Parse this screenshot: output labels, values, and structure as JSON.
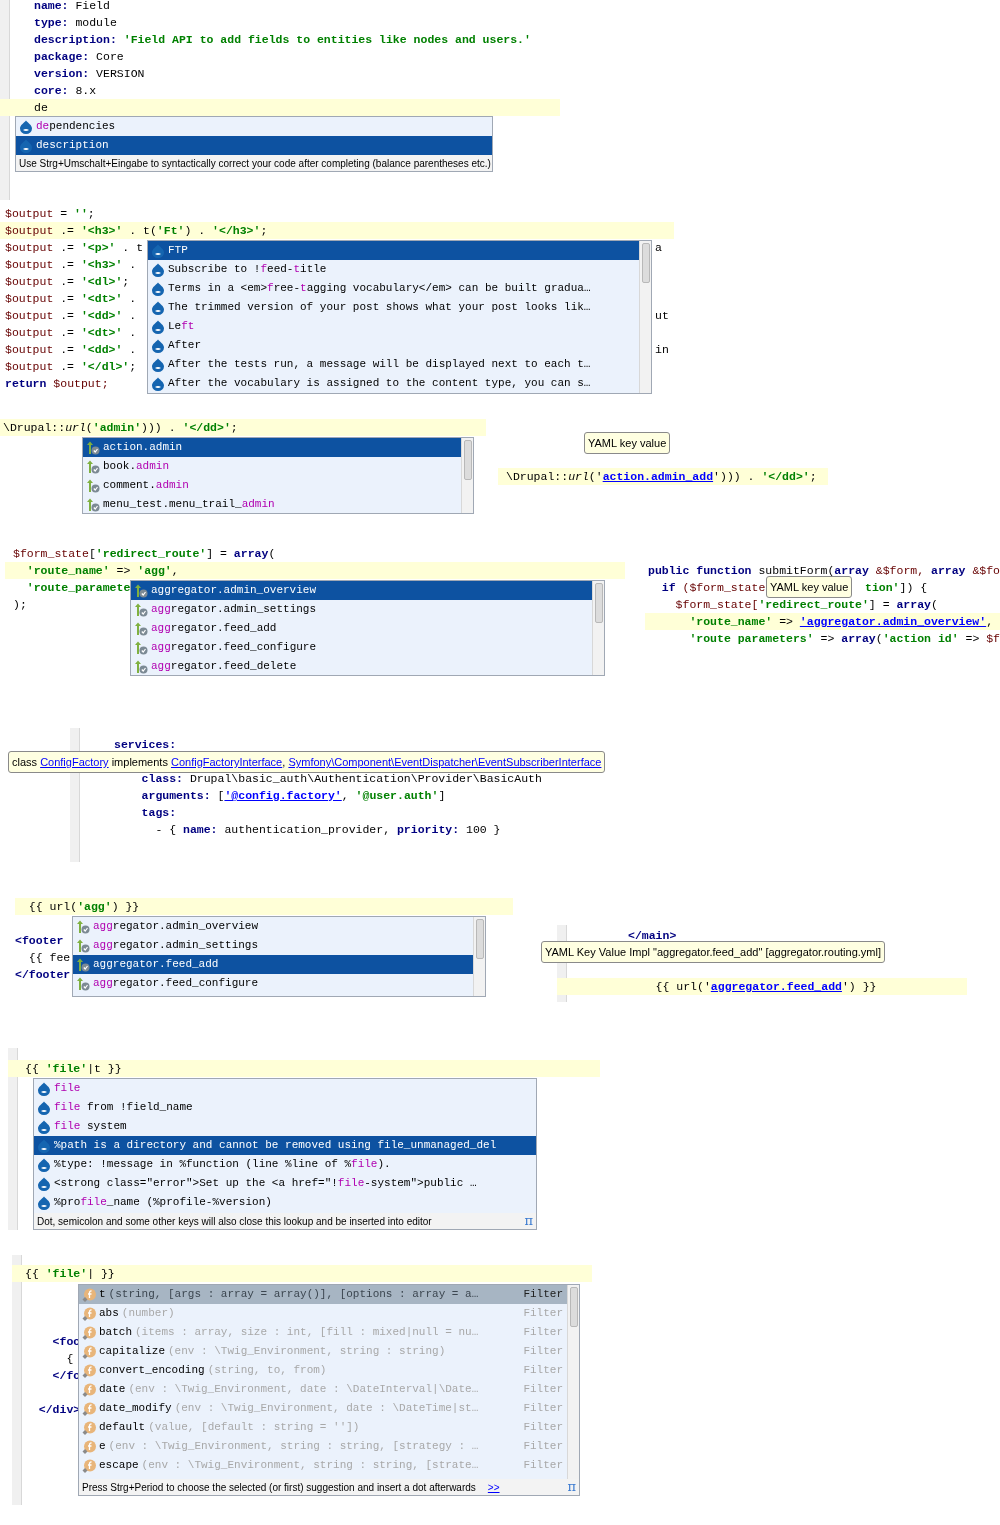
{
  "panels": [
    {
      "kind": "editor",
      "lines": [
        {
          "current": false,
          "segments": [
            {
              "text": "name:",
              "kind": "key"
            },
            {
              "text": " Field",
              "kind": "plain"
            }
          ]
        },
        {
          "current": false,
          "segments": [
            {
              "text": "type:",
              "kind": "key"
            },
            {
              "text": " module",
              "kind": "plain"
            }
          ]
        },
        {
          "current": false,
          "segments": [
            {
              "text": "description:",
              "kind": "key"
            },
            {
              "text": " 'Field API to add fields to entities like nodes and users.'",
              "kind": "str"
            }
          ]
        },
        {
          "current": false,
          "segments": [
            {
              "text": "package:",
              "kind": "key"
            },
            {
              "text": " Core",
              "kind": "plain"
            }
          ]
        },
        {
          "current": false,
          "segments": [
            {
              "text": "version:",
              "kind": "key"
            },
            {
              "text": " VERSION",
              "kind": "plain"
            }
          ]
        },
        {
          "current": false,
          "segments": [
            {
              "text": "core:",
              "kind": "key"
            },
            {
              "text": " 8.x",
              "kind": "plain"
            }
          ]
        },
        {
          "current": true,
          "segments": [
            {
              "text": "de",
              "kind": "plain"
            }
          ]
        }
      ],
      "popup": {
        "kind": "translation",
        "items": [
          {
            "selected": false,
            "segments": [
              {
                "text": "de",
                "kind": "match"
              },
              {
                "text": "pendencies",
                "kind": "plain"
              }
            ]
          },
          {
            "selected": true,
            "segments": [
              {
                "text": "description",
                "kind": "plain"
              }
            ]
          }
        ],
        "hint": "Use Strg+Umschalt+Eingabe to syntactically correct your code after completing (balance parentheses etc.)"
      }
    },
    {
      "kind": "editor",
      "lines": [
        {
          "current": false,
          "segments": [
            {
              "text": "$output",
              "kind": "var"
            },
            {
              "text": " = ",
              "kind": "plain"
            },
            {
              "text": "''",
              "kind": "str"
            },
            {
              "text": ";",
              "kind": "plain"
            }
          ]
        },
        {
          "current": true,
          "segments": [
            {
              "text": "$output",
              "kind": "var"
            },
            {
              "text": " .= ",
              "kind": "plain"
            },
            {
              "text": "'<h3>'",
              "kind": "str"
            },
            {
              "text": " . t(",
              "kind": "plain"
            },
            {
              "text": "'Ft'",
              "kind": "str"
            },
            {
              "text": ") . ",
              "kind": "plain"
            },
            {
              "text": "'</h3>'",
              "kind": "str"
            },
            {
              "text": ";",
              "kind": "plain"
            }
          ]
        },
        {
          "current": false,
          "segments": [
            {
              "text": "$output",
              "kind": "var"
            },
            {
              "text": " .= ",
              "kind": "plain"
            },
            {
              "text": "'<p>'",
              "kind": "str"
            },
            {
              "text": " . t",
              "kind": "plain"
            }
          ],
          "tail": [
            {
              "text": "a",
              "kind": "plain"
            }
          ]
        },
        {
          "current": false,
          "segments": [
            {
              "text": "$output",
              "kind": "var"
            },
            {
              "text": " .= ",
              "kind": "plain"
            },
            {
              "text": "'<h3>'",
              "kind": "str"
            },
            {
              "text": " .",
              "kind": "plain"
            }
          ]
        },
        {
          "current": false,
          "segments": [
            {
              "text": "$output",
              "kind": "var"
            },
            {
              "text": " .= ",
              "kind": "plain"
            },
            {
              "text": "'<dl>'",
              "kind": "str"
            },
            {
              "text": ";",
              "kind": "plain"
            }
          ]
        },
        {
          "current": false,
          "segments": [
            {
              "text": "$output",
              "kind": "var"
            },
            {
              "text": " .= ",
              "kind": "plain"
            },
            {
              "text": "'<dt>'",
              "kind": "str"
            },
            {
              "text": " .",
              "kind": "plain"
            }
          ]
        },
        {
          "current": false,
          "segments": [
            {
              "text": "$output",
              "kind": "var"
            },
            {
              "text": " .= ",
              "kind": "plain"
            },
            {
              "text": "'<dd>'",
              "kind": "str"
            },
            {
              "text": " .",
              "kind": "plain"
            }
          ],
          "tail": [
            {
              "text": "ut",
              "kind": "plain"
            }
          ]
        },
        {
          "current": false,
          "segments": [
            {
              "text": "$output",
              "kind": "var"
            },
            {
              "text": " .= ",
              "kind": "plain"
            },
            {
              "text": "'<dt>'",
              "kind": "str"
            },
            {
              "text": " .",
              "kind": "plain"
            }
          ]
        },
        {
          "current": false,
          "segments": [
            {
              "text": "$output",
              "kind": "var"
            },
            {
              "text": " .= ",
              "kind": "plain"
            },
            {
              "text": "'<dd>'",
              "kind": "str"
            },
            {
              "text": " .",
              "kind": "plain"
            }
          ],
          "tail": [
            {
              "text": "in",
              "kind": "plain"
            }
          ]
        },
        {
          "current": false,
          "segments": [
            {
              "text": "$output",
              "kind": "var"
            },
            {
              "text": " .= ",
              "kind": "plain"
            },
            {
              "text": "'</dl>'",
              "kind": "str"
            },
            {
              "text": ";",
              "kind": "plain"
            }
          ]
        },
        {
          "current": false,
          "segments": [
            {
              "text": "return",
              "kind": "kw"
            },
            {
              "text": " $output;",
              "kind": "var"
            }
          ]
        }
      ],
      "popup": {
        "kind": "translation",
        "items": [
          {
            "selected": true,
            "segments": [
              {
                "text": "FTP",
                "kind": "plain"
              }
            ]
          },
          {
            "selected": false,
            "segments": [
              {
                "text": "Subscribe to !",
                "kind": "plain"
              },
              {
                "text": "f",
                "kind": "match"
              },
              {
                "text": "eed-",
                "kind": "plain"
              },
              {
                "text": "t",
                "kind": "match"
              },
              {
                "text": "itle",
                "kind": "plain"
              }
            ]
          },
          {
            "selected": false,
            "segments": [
              {
                "text": "Terms in a <em>",
                "kind": "plain"
              },
              {
                "text": "f",
                "kind": "match"
              },
              {
                "text": "ree-",
                "kind": "plain"
              },
              {
                "text": "t",
                "kind": "match"
              },
              {
                "text": "agging vocabulary</em> can be built gradua…",
                "kind": "plain"
              }
            ]
          },
          {
            "selected": false,
            "segments": [
              {
                "text": "The trimmed version of your post shows what your post looks lik…",
                "kind": "plain"
              }
            ]
          },
          {
            "selected": false,
            "segments": [
              {
                "text": "Le",
                "kind": "plain"
              },
              {
                "text": "ft",
                "kind": "match"
              }
            ]
          },
          {
            "selected": false,
            "segments": [
              {
                "text": "After",
                "kind": "plain"
              }
            ]
          },
          {
            "selected": false,
            "segments": [
              {
                "text": "After the tests run, a message will be displayed next to each t…",
                "kind": "plain"
              }
            ]
          },
          {
            "selected": false,
            "segments": [
              {
                "text": "After the vocabulary is assigned to the content type, you can s…",
                "kind": "plain"
              }
            ]
          }
        ]
      }
    },
    {
      "kind": "editor",
      "lines": [
        {
          "current": true,
          "segments": [
            {
              "text": "\\Drupal::",
              "kind": "plain"
            },
            {
              "text": "url",
              "kind": "fn"
            },
            {
              "text": "(",
              "kind": "plain"
            },
            {
              "text": "'admin'",
              "kind": "str"
            },
            {
              "text": "))) . ",
              "kind": "plain"
            },
            {
              "text": "'</dd>'",
              "kind": "str"
            },
            {
              "text": ";",
              "kind": "plain"
            }
          ]
        }
      ],
      "popup": {
        "kind": "route",
        "items": [
          {
            "selected": true,
            "segments": [
              {
                "text": "action.admin",
                "kind": "plain"
              }
            ]
          },
          {
            "selected": false,
            "segments": [
              {
                "text": "book.",
                "kind": "plain"
              },
              {
                "text": "admin",
                "kind": "match"
              }
            ]
          },
          {
            "selected": false,
            "segments": [
              {
                "text": "comment.",
                "kind": "plain"
              },
              {
                "text": "admin",
                "kind": "match"
              }
            ]
          },
          {
            "selected": false,
            "segments": [
              {
                "text": "menu_test.menu_trail_",
                "kind": "plain"
              },
              {
                "text": "admin",
                "kind": "match"
              }
            ]
          }
        ]
      }
    },
    {
      "kind": "editor",
      "lines": [
        {
          "current": true,
          "segments": [
            {
              "text": "\\Drupal::",
              "kind": "plain"
            },
            {
              "text": "url",
              "kind": "fn"
            },
            {
              "text": "('",
              "kind": "plain"
            },
            {
              "text": "action.admin_add",
              "kind": "link"
            },
            {
              "text": "'))) . ",
              "kind": "plain"
            },
            {
              "text": "'</dd>'",
              "kind": "str"
            },
            {
              "text": ";",
              "kind": "plain"
            }
          ]
        }
      ],
      "tooltip": {
        "segments": [
          {
            "text": "YAML key value",
            "kind": "plain"
          }
        ]
      }
    },
    {
      "kind": "editor",
      "lines": [
        {
          "current": false,
          "segments": [
            {
              "text": "$form_state",
              "kind": "var"
            },
            {
              "text": "[",
              "kind": "plain"
            },
            {
              "text": "'redirect_route'",
              "kind": "str"
            },
            {
              "text": "] = ",
              "kind": "plain"
            },
            {
              "text": "array",
              "kind": "kw"
            },
            {
              "text": "(",
              "kind": "plain"
            }
          ]
        },
        {
          "current": true,
          "segments": [
            {
              "text": "  'route_name'",
              "kind": "str"
            },
            {
              "text": " => ",
              "kind": "plain"
            },
            {
              "text": "'agg'",
              "kind": "str"
            },
            {
              "text": ",",
              "kind": "plain"
            }
          ]
        },
        {
          "current": false,
          "segments": [
            {
              "text": "  'route_paramete",
              "kind": "str"
            }
          ]
        },
        {
          "current": false,
          "segments": [
            {
              "text": ");",
              "kind": "plain"
            }
          ]
        }
      ],
      "popup": {
        "kind": "route",
        "items": [
          {
            "selected": true,
            "segments": [
              {
                "text": "aggregator.admin_overview",
                "kind": "plain"
              }
            ]
          },
          {
            "selected": false,
            "segments": [
              {
                "text": "agg",
                "kind": "match"
              },
              {
                "text": "regator.admin_settings",
                "kind": "plain"
              }
            ]
          },
          {
            "selected": false,
            "segments": [
              {
                "text": "agg",
                "kind": "match"
              },
              {
                "text": "regator.feed_add",
                "kind": "plain"
              }
            ]
          },
          {
            "selected": false,
            "segments": [
              {
                "text": "agg",
                "kind": "match"
              },
              {
                "text": "regator.feed_configure",
                "kind": "plain"
              }
            ]
          },
          {
            "selected": false,
            "segments": [
              {
                "text": "agg",
                "kind": "match"
              },
              {
                "text": "regator.feed_delete",
                "kind": "plain"
              }
            ]
          }
        ]
      }
    },
    {
      "kind": "editor",
      "lines": [
        {
          "current": false,
          "segments": [
            {
              "text": "public function",
              "kind": "kw"
            },
            {
              "text": " submitForm(",
              "kind": "plain"
            },
            {
              "text": "array",
              "kind": "kw"
            },
            {
              "text": " &$form, ",
              "kind": "var"
            },
            {
              "text": "array",
              "kind": "kw"
            },
            {
              "text": " &$fo",
              "kind": "var"
            }
          ]
        },
        {
          "current": false,
          "segments": [
            {
              "text": "  if",
              "kind": "kw"
            },
            {
              "text": " ($form_state",
              "kind": "var"
            }
          ],
          "tail": [
            {
              "text": "tion'",
              "kind": "str"
            },
            {
              "text": "]) {",
              "kind": "plain"
            }
          ]
        },
        {
          "current": false,
          "segments": [
            {
              "text": "    $form_state[",
              "kind": "var"
            },
            {
              "text": "'redirect_route'",
              "kind": "str"
            },
            {
              "text": "] = ",
              "kind": "plain"
            },
            {
              "text": "array",
              "kind": "kw"
            },
            {
              "text": "(",
              "kind": "plain"
            }
          ]
        },
        {
          "current": true,
          "segments": [
            {
              "text": "      'route_name'",
              "kind": "str"
            },
            {
              "text": " => ",
              "kind": "plain"
            },
            {
              "text": "'aggregator.admin_overview'",
              "kind": "link"
            },
            {
              "text": ",",
              "kind": "plain"
            }
          ]
        },
        {
          "current": false,
          "segments": [
            {
              "text": "      'route parameters'",
              "kind": "str"
            },
            {
              "text": " => ",
              "kind": "plain"
            },
            {
              "text": "array",
              "kind": "kw"
            },
            {
              "text": "(",
              "kind": "plain"
            },
            {
              "text": "'action id'",
              "kind": "str"
            },
            {
              "text": " => ",
              "kind": "plain"
            },
            {
              "text": "$f",
              "kind": "var"
            }
          ]
        }
      ],
      "tooltip": {
        "segments": [
          {
            "text": "YAML key value",
            "kind": "plain"
          }
        ]
      }
    },
    {
      "kind": "editor",
      "lines": [
        {
          "current": false,
          "segments": [
            {
              "text": "services:",
              "kind": "key"
            }
          ]
        },
        {
          "current": false,
          "segments": [
            {
              "text": "    class:",
              "kind": "key"
            },
            {
              "text": " Drupal\\basic_auth\\Authentication\\Provider\\BasicAuth",
              "kind": "plain"
            }
          ]
        },
        {
          "current": false,
          "segments": [
            {
              "text": "    arguments:",
              "kind": "key"
            },
            {
              "text": " [",
              "kind": "plain"
            },
            {
              "text": "'@config.factory'",
              "kind": "link"
            },
            {
              "text": ", ",
              "kind": "plain"
            },
            {
              "text": "'@user.auth'",
              "kind": "str"
            },
            {
              "text": "]",
              "kind": "plain"
            }
          ]
        },
        {
          "current": false,
          "segments": [
            {
              "text": "    tags:",
              "kind": "key"
            }
          ]
        },
        {
          "current": false,
          "segments": [
            {
              "text": "      - { ",
              "kind": "plain"
            },
            {
              "text": "name:",
              "kind": "key"
            },
            {
              "text": " authentication_provider, ",
              "kind": "plain"
            },
            {
              "text": "priority:",
              "kind": "key"
            },
            {
              "text": " 100 }",
              "kind": "plain"
            }
          ]
        }
      ],
      "tooltip": {
        "segments": [
          {
            "text": "class ",
            "kind": "plain"
          },
          {
            "text": "ConfigFactory",
            "kind": "link"
          },
          {
            "text": " implements ",
            "kind": "plain"
          },
          {
            "text": "ConfigFactoryInterface",
            "kind": "link"
          },
          {
            "text": ", ",
            "kind": "plain"
          },
          {
            "text": "Symfony\\Component\\EventDispatcher\\EventSubscriberInterface",
            "kind": "link"
          }
        ]
      }
    },
    {
      "kind": "editor",
      "lines": [
        {
          "current": true,
          "segments": [
            {
              "text": "  {{ url(",
              "kind": "plain"
            },
            {
              "text": "'agg'",
              "kind": "str"
            },
            {
              "text": ") }}",
              "kind": "plain"
            }
          ]
        },
        {
          "current": false,
          "segments": [
            {
              "text": "<footer",
              "kind": "tag"
            }
          ]
        },
        {
          "current": false,
          "segments": [
            {
              "text": "  {{ fee",
              "kind": "plain"
            }
          ]
        },
        {
          "current": false,
          "segments": [
            {
              "text": "</footer",
              "kind": "tag"
            }
          ]
        }
      ],
      "popup": {
        "kind": "route",
        "items": [
          {
            "selected": false,
            "segments": [
              {
                "text": "agg",
                "kind": "match"
              },
              {
                "text": "regator.admin_overview",
                "kind": "plain"
              }
            ]
          },
          {
            "selected": false,
            "segments": [
              {
                "text": "agg",
                "kind": "match"
              },
              {
                "text": "regator.admin_settings",
                "kind": "plain"
              }
            ]
          },
          {
            "selected": true,
            "segments": [
              {
                "text": "aggregator.feed_add",
                "kind": "plain"
              }
            ]
          },
          {
            "selected": false,
            "segments": [
              {
                "text": "agg",
                "kind": "match"
              },
              {
                "text": "regator.feed_configure",
                "kind": "plain"
              }
            ]
          }
        ]
      }
    },
    {
      "kind": "editor",
      "lines": [
        {
          "current": false,
          "segments": [
            {
              "text": "</main>",
              "kind": "tag"
            }
          ]
        },
        {
          "current": true,
          "segments": [
            {
              "text": "    {{ url('",
              "kind": "plain"
            },
            {
              "text": "aggregator.feed_add",
              "kind": "link"
            },
            {
              "text": "') }}",
              "kind": "plain"
            }
          ]
        }
      ],
      "tooltip": {
        "segments": [
          {
            "text": "YAML Key Value Impl \"aggregator.feed_add\" [aggregator.routing.yml]",
            "kind": "plain"
          }
        ]
      }
    },
    {
      "kind": "editor",
      "lines": [
        {
          "current": true,
          "segments": [
            {
              "text": "{{ ",
              "kind": "plain"
            },
            {
              "text": "'file'",
              "kind": "str"
            },
            {
              "text": "|t }}",
              "kind": "plain"
            }
          ]
        }
      ],
      "popup": {
        "kind": "translation",
        "items": [
          {
            "selected": false,
            "segments": [
              {
                "text": "file",
                "kind": "match"
              }
            ]
          },
          {
            "selected": false,
            "segments": [
              {
                "text": "file",
                "kind": "match"
              },
              {
                "text": " from !field_name",
                "kind": "plain"
              }
            ]
          },
          {
            "selected": false,
            "segments": [
              {
                "text": "file",
                "kind": "match"
              },
              {
                "text": " system",
                "kind": "plain"
              }
            ]
          },
          {
            "selected": true,
            "segments": [
              {
                "text": "%path is a directory and cannot be removed using file_unmanaged_del",
                "kind": "plain"
              }
            ]
          },
          {
            "selected": false,
            "segments": [
              {
                "text": "%type: !message in %function (line %line of %",
                "kind": "plain"
              },
              {
                "text": "file",
                "kind": "match"
              },
              {
                "text": ").",
                "kind": "plain"
              }
            ]
          },
          {
            "selected": false,
            "segments": [
              {
                "text": "<strong class=\"error\">Set up the <a href=\"!",
                "kind": "plain"
              },
              {
                "text": "file",
                "kind": "match"
              },
              {
                "text": "-system\">public …",
                "kind": "plain"
              }
            ]
          },
          {
            "selected": false,
            "segments": [
              {
                "text": "%pro",
                "kind": "plain"
              },
              {
                "text": "file",
                "kind": "match"
              },
              {
                "text": "_name (%profile-%version)",
                "kind": "plain"
              }
            ]
          }
        ],
        "hint": "Dot, semicolon and some other keys will also close this lookup and be inserted into editor",
        "pi": "π"
      }
    },
    {
      "kind": "editor",
      "lines": [
        {
          "current": true,
          "segments": [
            {
              "text": "{{ ",
              "kind": "plain"
            },
            {
              "text": "'file'",
              "kind": "str"
            },
            {
              "text": "| }}",
              "kind": "plain"
            }
          ]
        },
        {
          "current": false,
          "segments": [
            {
              "text": "    <foo",
              "kind": "tag"
            }
          ]
        },
        {
          "current": false,
          "segments": [
            {
              "text": "      {",
              "kind": "plain"
            }
          ]
        },
        {
          "current": false,
          "segments": [
            {
              "text": "    </fo",
              "kind": "tag"
            }
          ]
        },
        {
          "current": false,
          "segments": [
            {
              "text": "  </div>",
              "kind": "tag"
            }
          ]
        }
      ],
      "popup": {
        "kind": "filter",
        "items": [
          {
            "selected": true,
            "name": "t",
            "signature": "(string, [args : array = array()], [options : array = a…",
            "type_label": "Filter"
          },
          {
            "selected": false,
            "name": "abs",
            "signature": "(number)",
            "type_label": "Filter"
          },
          {
            "selected": false,
            "name": "batch",
            "signature": "(items : array, size : int, [fill : mixed|null = nu…",
            "type_label": "Filter"
          },
          {
            "selected": false,
            "name": "capitalize",
            "signature": "(env : \\Twig_Environment, string : string)",
            "type_label": "Filter"
          },
          {
            "selected": false,
            "name": "convert_encoding",
            "signature": "(string, to, from)",
            "type_label": "Filter"
          },
          {
            "selected": false,
            "name": "date",
            "signature": "(env : \\Twig_Environment, date : \\DateInterval|\\Date…",
            "type_label": "Filter"
          },
          {
            "selected": false,
            "name": "date_modify",
            "signature": "(env : \\Twig_Environment, date : \\DateTime|st…",
            "type_label": "Filter"
          },
          {
            "selected": false,
            "name": "default",
            "signature": "(value, [default : string = ''])",
            "type_label": "Filter"
          },
          {
            "selected": false,
            "name": "e",
            "signature": "(env : \\Twig_Environment, string : string, [strategy : …",
            "type_label": "Filter"
          },
          {
            "selected": false,
            "name": "escape",
            "signature": "(env : \\Twig_Environment, string : string, [strate…",
            "type_label": "Filter"
          }
        ],
        "hint": "Press Strg+Period to choose the selected (or first) suggestion and insert a dot afterwards",
        "hint_link": ">>",
        "pi": "π"
      }
    }
  ]
}
